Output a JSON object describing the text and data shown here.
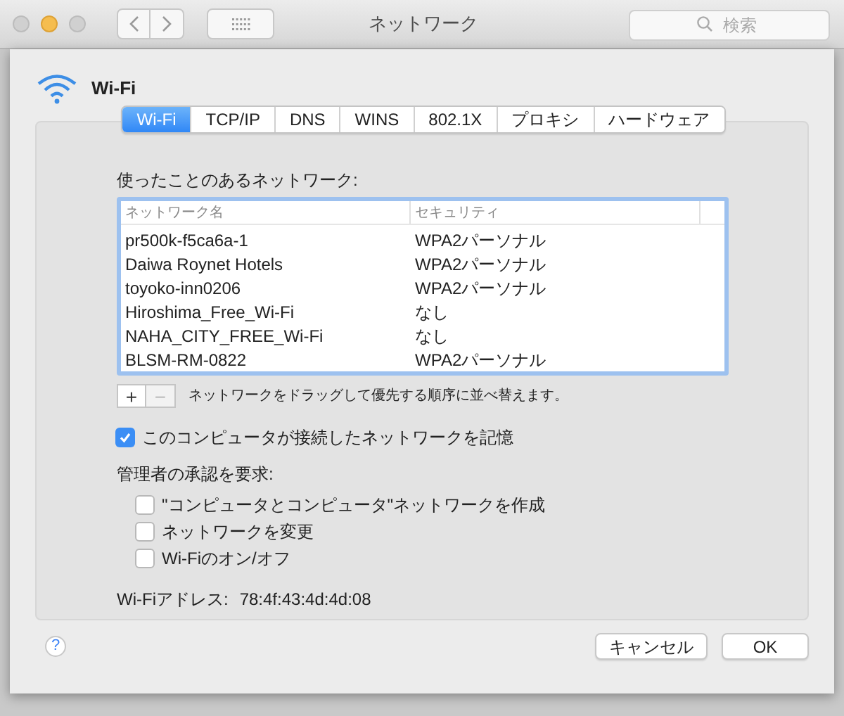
{
  "window": {
    "title": "ネットワーク",
    "search": {
      "placeholder": "検索"
    }
  },
  "header": {
    "title": "Wi-Fi"
  },
  "tabs": [
    {
      "label": "Wi-Fi",
      "selected": true
    },
    {
      "label": "TCP/IP",
      "selected": false
    },
    {
      "label": "DNS",
      "selected": false
    },
    {
      "label": "WINS",
      "selected": false
    },
    {
      "label": "802.1X",
      "selected": false
    },
    {
      "label": "プロキシ",
      "selected": false
    },
    {
      "label": "ハードウェア",
      "selected": false
    }
  ],
  "networks_label": "使ったことのあるネットワーク:",
  "table": {
    "columns": [
      "ネットワーク名",
      "セキュリティ"
    ],
    "rows": [
      [
        "pr500k-f5ca6a-1",
        "WPA2パーソナル"
      ],
      [
        "Daiwa Roynet Hotels",
        "WPA2パーソナル"
      ],
      [
        "toyoko-inn0206",
        "WPA2パーソナル"
      ],
      [
        "Hiroshima_Free_Wi-Fi",
        "なし"
      ],
      [
        "NAHA_CITY_FREE_Wi-Fi",
        "なし"
      ],
      [
        "BLSM-RM-0822",
        "WPA2パーソナル"
      ]
    ]
  },
  "list_buttons": [
    {
      "label": "+",
      "disabled": false
    },
    {
      "label": "−",
      "disabled": true
    }
  ],
  "drag_hint": "ネットワークをドラッグして優先する順序に並べ替えます。",
  "remember": {
    "label": "このコンピュータが接続したネットワークを記憶",
    "checked": true
  },
  "admin_label": "管理者の承認を要求:",
  "admin_options": [
    {
      "label": "\"コンピュータとコンピュータ\"ネットワークを作成",
      "checked": false
    },
    {
      "label": "ネットワークを変更",
      "checked": false
    },
    {
      "label": "Wi-Fiのオン/オフ",
      "checked": false
    }
  ],
  "address": {
    "label": "Wi-Fiアドレス:",
    "value": "78:4f:43:4d:4d:08"
  },
  "help": "?",
  "buttons": [
    "キャンセル",
    "OK"
  ]
}
